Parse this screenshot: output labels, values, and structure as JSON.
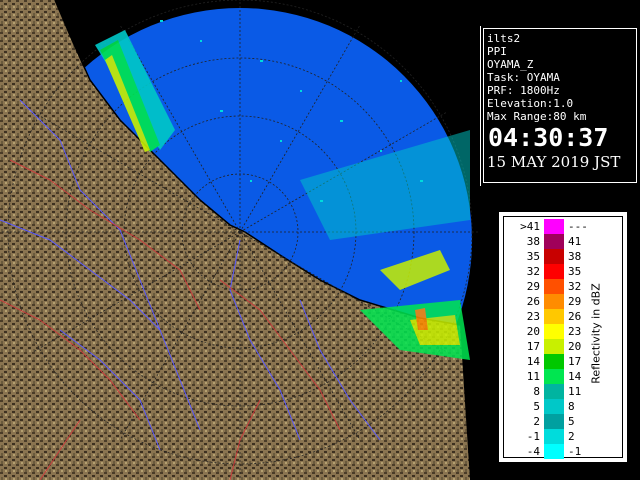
{
  "info": {
    "lines": [
      "ilts2",
      "PPI",
      "OYAMA_Z",
      "Task: OYAMA",
      "PRF: 1800Hz",
      "Elevation:1.0",
      "Max Range:80 km"
    ],
    "time": "04:30:37",
    "date": "15 MAY 2019 JST"
  },
  "legend": {
    "title": "Reflectivity in dBZ",
    "rows": [
      {
        "lo": ">41",
        "hi": "---",
        "color": "#ff00ff"
      },
      {
        "lo": "38",
        "hi": "41",
        "color": "#a0005a"
      },
      {
        "lo": "35",
        "hi": "38",
        "color": "#c80000"
      },
      {
        "lo": "32",
        "hi": "35",
        "color": "#ff0000"
      },
      {
        "lo": "29",
        "hi": "32",
        "color": "#ff5000"
      },
      {
        "lo": "26",
        "hi": "29",
        "color": "#ff8c00"
      },
      {
        "lo": "23",
        "hi": "26",
        "color": "#ffc800"
      },
      {
        "lo": "20",
        "hi": "23",
        "color": "#ffff00"
      },
      {
        "lo": "17",
        "hi": "20",
        "color": "#c8f000"
      },
      {
        "lo": "14",
        "hi": "17",
        "color": "#00c800"
      },
      {
        "lo": "11",
        "hi": "14",
        "color": "#00e650"
      },
      {
        "lo": "8",
        "hi": "11",
        "color": "#00b4a0"
      },
      {
        "lo": "5",
        "hi": "8",
        "color": "#00c8c8"
      },
      {
        "lo": "2",
        "hi": "5",
        "color": "#00a0a0"
      },
      {
        "lo": "-1",
        "hi": "2",
        "color": "#00dcdc"
      },
      {
        "lo": "-4",
        "hi": "-1",
        "color": "#00ffff"
      }
    ]
  },
  "colors": {
    "sea": "#0a5ae6",
    "outside": "#000000",
    "land": "#8a7450",
    "land_dark": "#3c3020",
    "rivers": "#5a5aff",
    "roads": "#c83c3c",
    "coast": "#000000"
  }
}
